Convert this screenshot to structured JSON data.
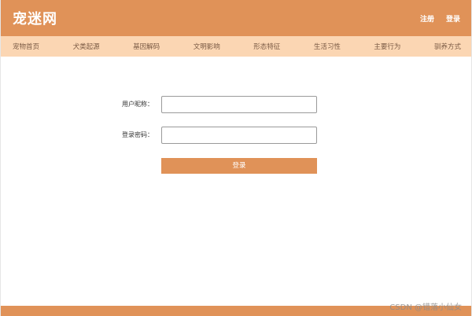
{
  "header": {
    "logo": "宠迷网",
    "register_label": "注册",
    "login_label": "登录"
  },
  "nav": {
    "items": [
      {
        "label": "宠物首页"
      },
      {
        "label": "犬类起源"
      },
      {
        "label": "基因解码"
      },
      {
        "label": "文明影响"
      },
      {
        "label": "形态特征"
      },
      {
        "label": "生活习性"
      },
      {
        "label": "主要行为"
      },
      {
        "label": "驯养方式"
      }
    ]
  },
  "form": {
    "nickname_label": "用户昵称：",
    "nickname_value": "",
    "password_label": "登录密码：",
    "password_value": "",
    "submit_label": "登录"
  },
  "watermark": "CSDN @错落小仙女",
  "colors": {
    "primary": "#e09258",
    "nav_bg": "#fbd6b3",
    "nav_text": "#7a5a44"
  }
}
